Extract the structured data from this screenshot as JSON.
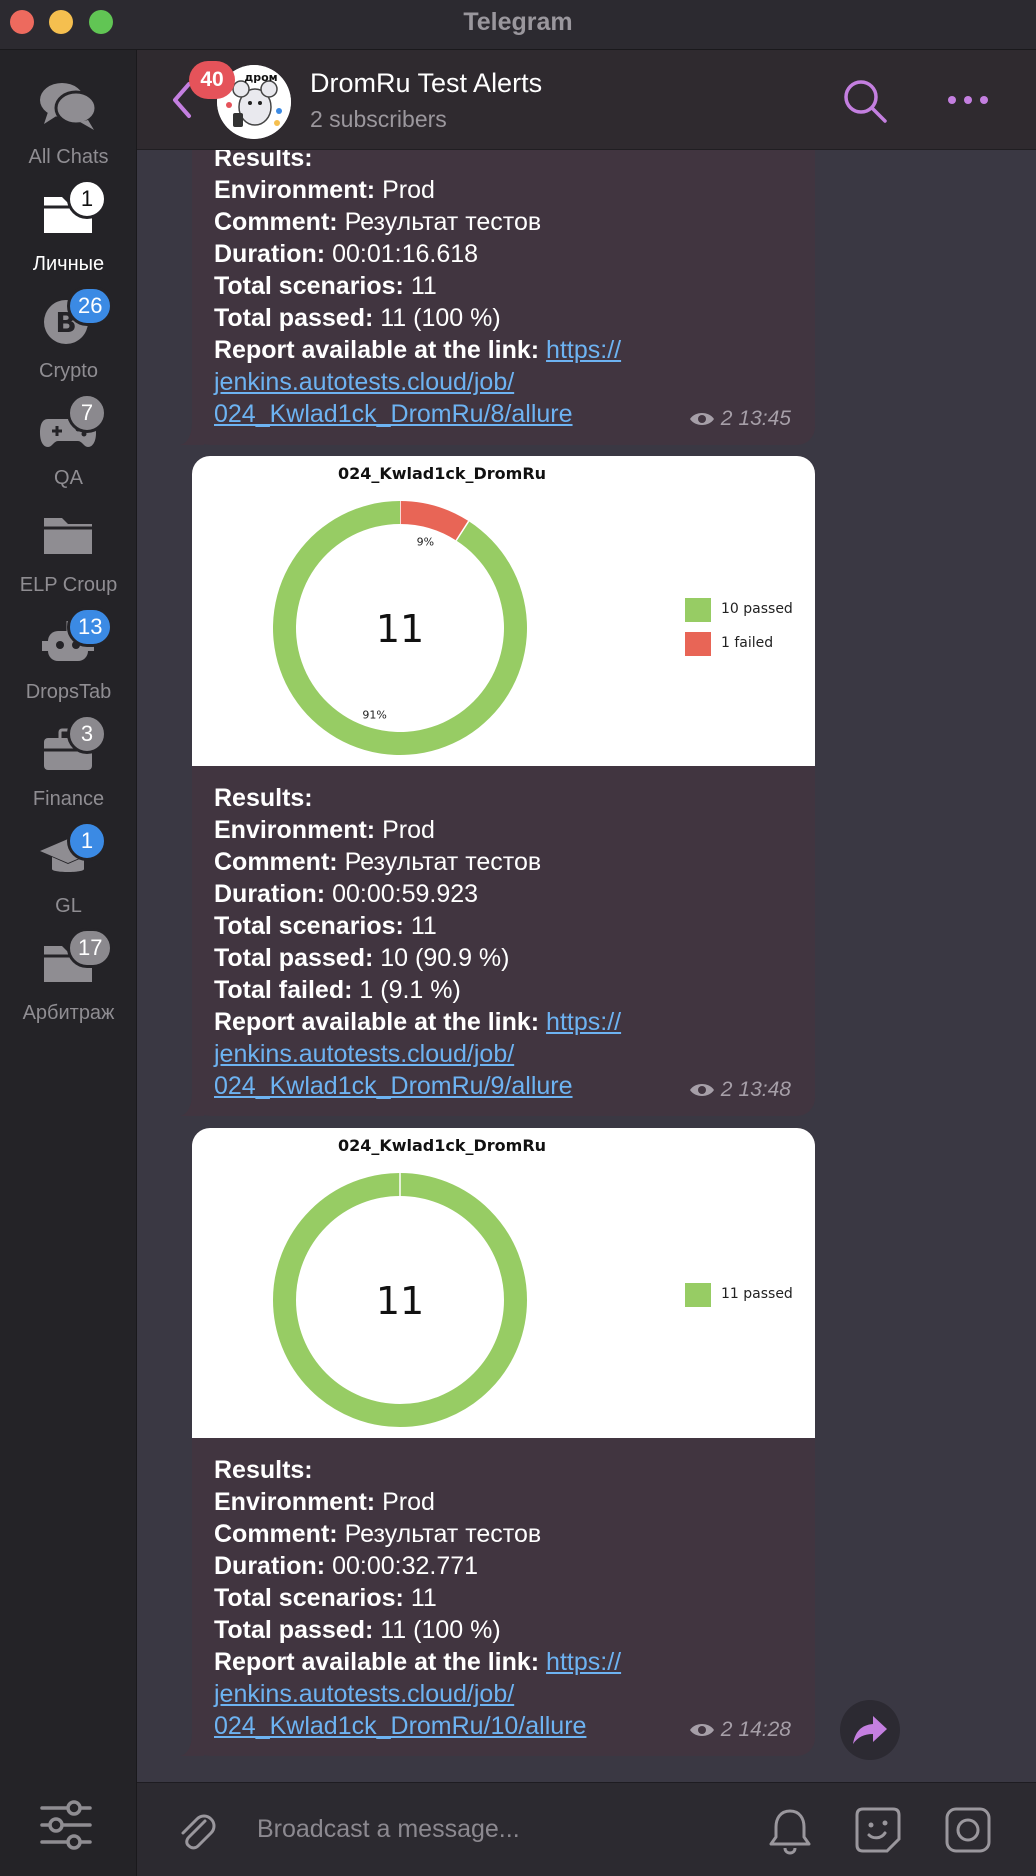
{
  "window": {
    "title": "Telegram"
  },
  "sidebar": {
    "folders": [
      {
        "label": "All Chats",
        "badge": "",
        "icon": "chats-icon"
      },
      {
        "label": "Личные",
        "badge": "1",
        "icon": "folder-icon",
        "active": true
      },
      {
        "label": "Crypto",
        "badge": "26",
        "icon": "bitcoin-icon"
      },
      {
        "label": "QA",
        "badge": "7",
        "icon": "gamepad-icon"
      },
      {
        "label": "ELP Croup",
        "badge": "",
        "icon": "folder-icon"
      },
      {
        "label": "DropsTab",
        "badge": "13",
        "icon": "bot-icon"
      },
      {
        "label": "Finance",
        "badge": "3",
        "icon": "briefcase-icon"
      },
      {
        "label": "GL",
        "badge": "1",
        "icon": "graduation-cap-icon"
      },
      {
        "label": "Арбитраж",
        "badge": "17",
        "icon": "folder-icon"
      }
    ]
  },
  "header": {
    "unread_badge": "40",
    "title": "DromRu Test Alerts",
    "subtitle": "2 subscribers",
    "avatar_text": "дром"
  },
  "labels": {
    "results": "Results:",
    "environment": "Environment:",
    "comment": "Comment:",
    "duration": "Duration:",
    "total_scenarios": "Total scenarios:",
    "total_passed": "Total passed:",
    "total_failed": "Total failed:",
    "report": "Report available at the link:"
  },
  "messages": [
    {
      "environment": "Prod",
      "comment": "Результат тестов",
      "duration": "00:01:16.618",
      "total_scenarios": "11",
      "total_passed": "11 (100 %)",
      "link_lines": [
        "https://",
        "jenkins.autotests.cloud/job/",
        "024_Kwlad1ck_DromRu/8/allure"
      ],
      "views": "2",
      "time": "13:45"
    },
    {
      "chart_title": "024_Kwlad1ck_DromRu",
      "environment": "Prod",
      "comment": "Результат тестов",
      "duration": "00:00:59.923",
      "total_scenarios": "11",
      "total_passed": "10 (90.9 %)",
      "total_failed": "1 (9.1 %)",
      "link_lines": [
        "https://",
        "jenkins.autotests.cloud/job/",
        "024_Kwlad1ck_DromRu/9/allure"
      ],
      "views": "2",
      "time": "13:48"
    },
    {
      "chart_title": "024_Kwlad1ck_DromRu",
      "environment": "Prod",
      "comment": "Результат тестов",
      "duration": "00:00:32.771",
      "total_scenarios": "11",
      "total_passed": "11 (100 %)",
      "link_lines": [
        "https://",
        "jenkins.autotests.cloud/job/",
        "024_Kwlad1ck_DromRu/10/allure"
      ],
      "views": "2",
      "time": "14:28"
    }
  ],
  "chart_data": [
    {
      "type": "pie",
      "title": "024_Kwlad1ck_DromRu",
      "center_label": "11",
      "categories": [
        "passed",
        "failed"
      ],
      "values": [
        10,
        1
      ],
      "slice_labels": [
        "91%",
        "9%"
      ],
      "legend": [
        "10 passed",
        "1 failed"
      ],
      "colors": [
        "#97cc64",
        "#e86556"
      ],
      "legend_position": "right"
    },
    {
      "type": "pie",
      "title": "024_Kwlad1ck_DromRu",
      "center_label": "11",
      "categories": [
        "passed"
      ],
      "values": [
        11
      ],
      "slice_labels": [],
      "legend": [
        "11 passed"
      ],
      "colors": [
        "#97cc64"
      ],
      "legend_position": "right"
    }
  ],
  "composer": {
    "placeholder": "Broadcast a message..."
  },
  "colors": {
    "accent": "#c47fe0",
    "link": "#6db3f2",
    "bubble": "#413540",
    "passed": "#97cc64",
    "failed": "#e86556"
  }
}
